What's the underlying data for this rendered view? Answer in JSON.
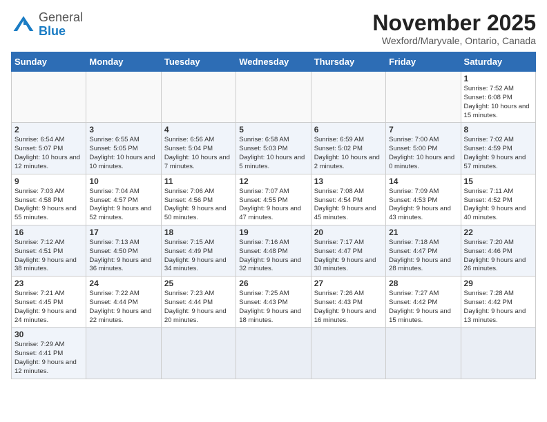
{
  "header": {
    "logo_general": "General",
    "logo_blue": "Blue",
    "month_title": "November 2025",
    "subtitle": "Wexford/Maryvale, Ontario, Canada"
  },
  "weekdays": [
    "Sunday",
    "Monday",
    "Tuesday",
    "Wednesday",
    "Thursday",
    "Friday",
    "Saturday"
  ],
  "weeks": [
    [
      {
        "day": "",
        "info": ""
      },
      {
        "day": "",
        "info": ""
      },
      {
        "day": "",
        "info": ""
      },
      {
        "day": "",
        "info": ""
      },
      {
        "day": "",
        "info": ""
      },
      {
        "day": "",
        "info": ""
      },
      {
        "day": "1",
        "info": "Sunrise: 7:52 AM\nSunset: 6:08 PM\nDaylight: 10 hours and 15 minutes."
      }
    ],
    [
      {
        "day": "2",
        "info": "Sunrise: 6:54 AM\nSunset: 5:07 PM\nDaylight: 10 hours and 12 minutes."
      },
      {
        "day": "3",
        "info": "Sunrise: 6:55 AM\nSunset: 5:05 PM\nDaylight: 10 hours and 10 minutes."
      },
      {
        "day": "4",
        "info": "Sunrise: 6:56 AM\nSunset: 5:04 PM\nDaylight: 10 hours and 7 minutes."
      },
      {
        "day": "5",
        "info": "Sunrise: 6:58 AM\nSunset: 5:03 PM\nDaylight: 10 hours and 5 minutes."
      },
      {
        "day": "6",
        "info": "Sunrise: 6:59 AM\nSunset: 5:02 PM\nDaylight: 10 hours and 2 minutes."
      },
      {
        "day": "7",
        "info": "Sunrise: 7:00 AM\nSunset: 5:00 PM\nDaylight: 10 hours and 0 minutes."
      },
      {
        "day": "8",
        "info": "Sunrise: 7:02 AM\nSunset: 4:59 PM\nDaylight: 9 hours and 57 minutes."
      }
    ],
    [
      {
        "day": "9",
        "info": "Sunrise: 7:03 AM\nSunset: 4:58 PM\nDaylight: 9 hours and 55 minutes."
      },
      {
        "day": "10",
        "info": "Sunrise: 7:04 AM\nSunset: 4:57 PM\nDaylight: 9 hours and 52 minutes."
      },
      {
        "day": "11",
        "info": "Sunrise: 7:06 AM\nSunset: 4:56 PM\nDaylight: 9 hours and 50 minutes."
      },
      {
        "day": "12",
        "info": "Sunrise: 7:07 AM\nSunset: 4:55 PM\nDaylight: 9 hours and 47 minutes."
      },
      {
        "day": "13",
        "info": "Sunrise: 7:08 AM\nSunset: 4:54 PM\nDaylight: 9 hours and 45 minutes."
      },
      {
        "day": "14",
        "info": "Sunrise: 7:09 AM\nSunset: 4:53 PM\nDaylight: 9 hours and 43 minutes."
      },
      {
        "day": "15",
        "info": "Sunrise: 7:11 AM\nSunset: 4:52 PM\nDaylight: 9 hours and 40 minutes."
      }
    ],
    [
      {
        "day": "16",
        "info": "Sunrise: 7:12 AM\nSunset: 4:51 PM\nDaylight: 9 hours and 38 minutes."
      },
      {
        "day": "17",
        "info": "Sunrise: 7:13 AM\nSunset: 4:50 PM\nDaylight: 9 hours and 36 minutes."
      },
      {
        "day": "18",
        "info": "Sunrise: 7:15 AM\nSunset: 4:49 PM\nDaylight: 9 hours and 34 minutes."
      },
      {
        "day": "19",
        "info": "Sunrise: 7:16 AM\nSunset: 4:48 PM\nDaylight: 9 hours and 32 minutes."
      },
      {
        "day": "20",
        "info": "Sunrise: 7:17 AM\nSunset: 4:47 PM\nDaylight: 9 hours and 30 minutes."
      },
      {
        "day": "21",
        "info": "Sunrise: 7:18 AM\nSunset: 4:47 PM\nDaylight: 9 hours and 28 minutes."
      },
      {
        "day": "22",
        "info": "Sunrise: 7:20 AM\nSunset: 4:46 PM\nDaylight: 9 hours and 26 minutes."
      }
    ],
    [
      {
        "day": "23",
        "info": "Sunrise: 7:21 AM\nSunset: 4:45 PM\nDaylight: 9 hours and 24 minutes."
      },
      {
        "day": "24",
        "info": "Sunrise: 7:22 AM\nSunset: 4:44 PM\nDaylight: 9 hours and 22 minutes."
      },
      {
        "day": "25",
        "info": "Sunrise: 7:23 AM\nSunset: 4:44 PM\nDaylight: 9 hours and 20 minutes."
      },
      {
        "day": "26",
        "info": "Sunrise: 7:25 AM\nSunset: 4:43 PM\nDaylight: 9 hours and 18 minutes."
      },
      {
        "day": "27",
        "info": "Sunrise: 7:26 AM\nSunset: 4:43 PM\nDaylight: 9 hours and 16 minutes."
      },
      {
        "day": "28",
        "info": "Sunrise: 7:27 AM\nSunset: 4:42 PM\nDaylight: 9 hours and 15 minutes."
      },
      {
        "day": "29",
        "info": "Sunrise: 7:28 AM\nSunset: 4:42 PM\nDaylight: 9 hours and 13 minutes."
      }
    ],
    [
      {
        "day": "30",
        "info": "Sunrise: 7:29 AM\nSunset: 4:41 PM\nDaylight: 9 hours and 12 minutes."
      },
      {
        "day": "",
        "info": ""
      },
      {
        "day": "",
        "info": ""
      },
      {
        "day": "",
        "info": ""
      },
      {
        "day": "",
        "info": ""
      },
      {
        "day": "",
        "info": ""
      },
      {
        "day": "",
        "info": ""
      }
    ]
  ]
}
